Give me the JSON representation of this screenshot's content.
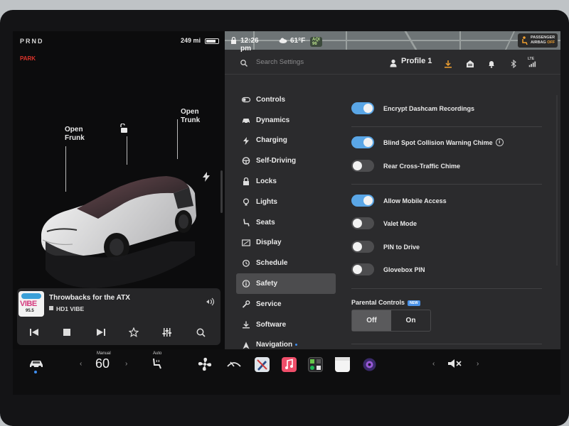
{
  "status": {
    "gears": "PRND",
    "gear_state": "PARK",
    "range": "249 mi",
    "time": "12:26 pm",
    "temperature": "61°F",
    "aqi": "AQI 96",
    "airbag_line1": "PASSENGER",
    "airbag_line2": "AIRBAG",
    "airbag_state": "OFF"
  },
  "car": {
    "frunk_label": "Open\nFrunk",
    "trunk_label": "Open\nTrunk"
  },
  "media": {
    "album_text": "VIBE",
    "album_sub": "95.5",
    "title": "Throwbacks for the ATX",
    "station": "HD1 VIBE"
  },
  "header": {
    "search_placeholder": "Search Settings",
    "profile": "Profile 1",
    "signal_label": "LTE"
  },
  "menu": [
    {
      "label": "Controls",
      "icon": "toggle-icon"
    },
    {
      "label": "Dynamics",
      "icon": "car-icon"
    },
    {
      "label": "Charging",
      "icon": "bolt-icon"
    },
    {
      "label": "Self-Driving",
      "icon": "steering-wheel-icon"
    },
    {
      "label": "Locks",
      "icon": "lock-icon"
    },
    {
      "label": "Lights",
      "icon": "bulb-icon"
    },
    {
      "label": "Seats",
      "icon": "seat-icon"
    },
    {
      "label": "Display",
      "icon": "display-icon"
    },
    {
      "label": "Schedule",
      "icon": "clock-icon"
    },
    {
      "label": "Safety",
      "icon": "info-icon",
      "active": true
    },
    {
      "label": "Service",
      "icon": "wrench-icon"
    },
    {
      "label": "Software",
      "icon": "download-icon"
    },
    {
      "label": "Navigation",
      "icon": "navigation-icon"
    }
  ],
  "settings": {
    "encrypt_dashcam": {
      "label": "Encrypt Dashcam Recordings",
      "on": true
    },
    "blind_spot": {
      "label": "Blind Spot Collision Warning Chime",
      "on": true
    },
    "rear_cross": {
      "label": "Rear Cross-Traffic Chime",
      "on": false
    },
    "mobile_access": {
      "label": "Allow Mobile Access",
      "on": true
    },
    "valet": {
      "label": "Valet Mode",
      "on": false
    },
    "pin_drive": {
      "label": "PIN to Drive",
      "on": false
    },
    "glovebox": {
      "label": "Glovebox PIN",
      "on": false
    },
    "parental_label": "Parental Controls",
    "new_badge": "NEW",
    "parental_off": "Off",
    "parental_on": "On"
  },
  "dock": {
    "left_temp_label": "Manual",
    "left_temp": "60",
    "seat_label": "Auto"
  },
  "colors": {
    "toggle_on": "#5aa6e6",
    "park_red": "#e0342b",
    "accent_orange": "#f0a030"
  }
}
